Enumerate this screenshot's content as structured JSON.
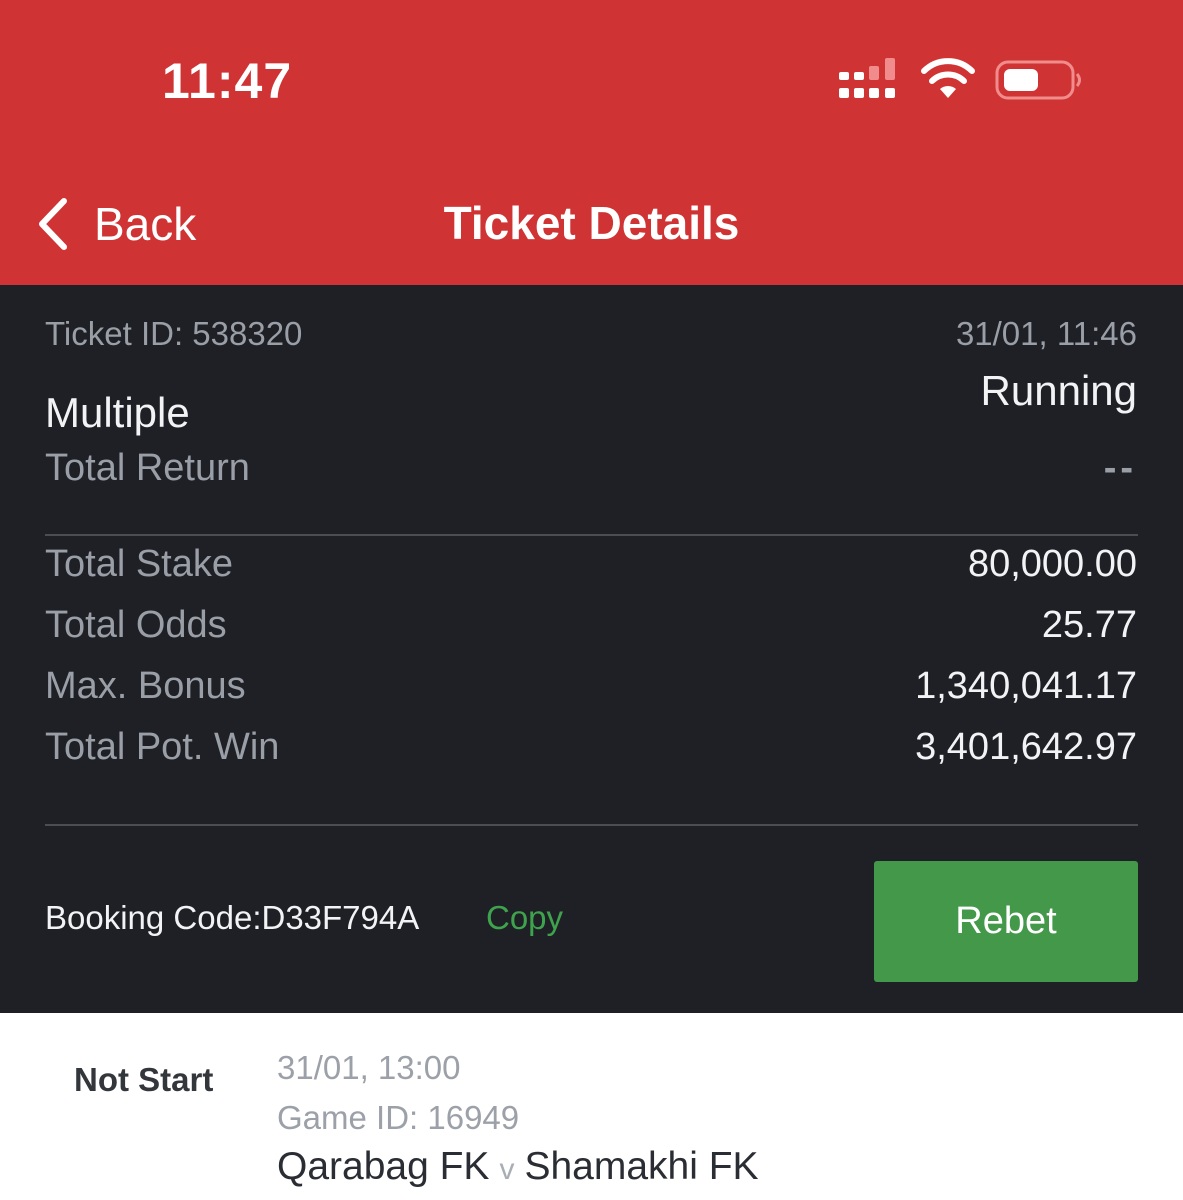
{
  "status_bar": {
    "time": "11:47",
    "icons": [
      "cellular-signal-icon",
      "wifi-icon",
      "battery-icon"
    ]
  },
  "nav": {
    "back_label": "Back",
    "title": "Ticket Details"
  },
  "ticket": {
    "id_text": "Ticket ID: 538320",
    "date_time": "31/01, 11:46",
    "status": "Running",
    "bet_type": "Multiple",
    "total_return_label": "Total Return",
    "total_return_value": "--",
    "rows": [
      {
        "label": "Total Stake",
        "value": "80,000.00"
      },
      {
        "label": "Total Odds",
        "value": "25.77"
      },
      {
        "label": "Max. Bonus",
        "value": "1,340,041.17"
      },
      {
        "label": "Total Pot. Win",
        "value": "3,401,642.97"
      }
    ],
    "booking_code_text": "Booking Code:D33F794A",
    "copy_label": "Copy",
    "rebet_label": "Rebet"
  },
  "match": {
    "status": "Not Start",
    "date_time": "31/01, 13:00",
    "game_id_text": "Game ID: 16949",
    "home_team": "Qarabag FK",
    "vs": "v",
    "away_team": "Shamakhi FK"
  },
  "colors": {
    "header_red": "#d03333",
    "panel_dark": "#1e2026",
    "rebet_green": "#43984a",
    "copy_green": "#3fa34d"
  }
}
